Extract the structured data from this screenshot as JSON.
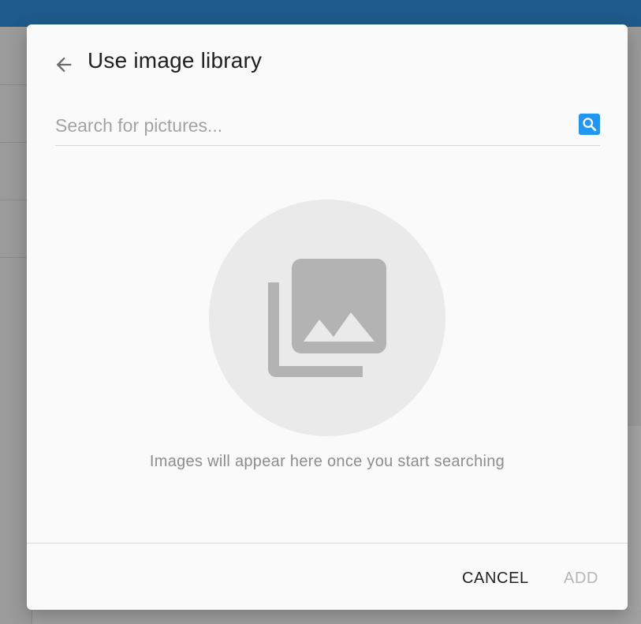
{
  "dialog": {
    "title": "Use image library",
    "back_icon": "arrow-left-icon"
  },
  "search": {
    "placeholder": "Search for pictures...",
    "value": "",
    "icon": "search-icon",
    "accent_color": "#2196f3"
  },
  "empty_state": {
    "icon": "photo-library-icon",
    "message": "Images will appear here once you start searching"
  },
  "footer": {
    "cancel_label": "CANCEL",
    "add_label": "ADD",
    "add_disabled": true
  },
  "colors": {
    "topbar": "#1e5a8a",
    "dialog_bg": "#fafafa",
    "illustration_bg": "#eaeaea",
    "illustration_icon": "#b3b3b3"
  }
}
